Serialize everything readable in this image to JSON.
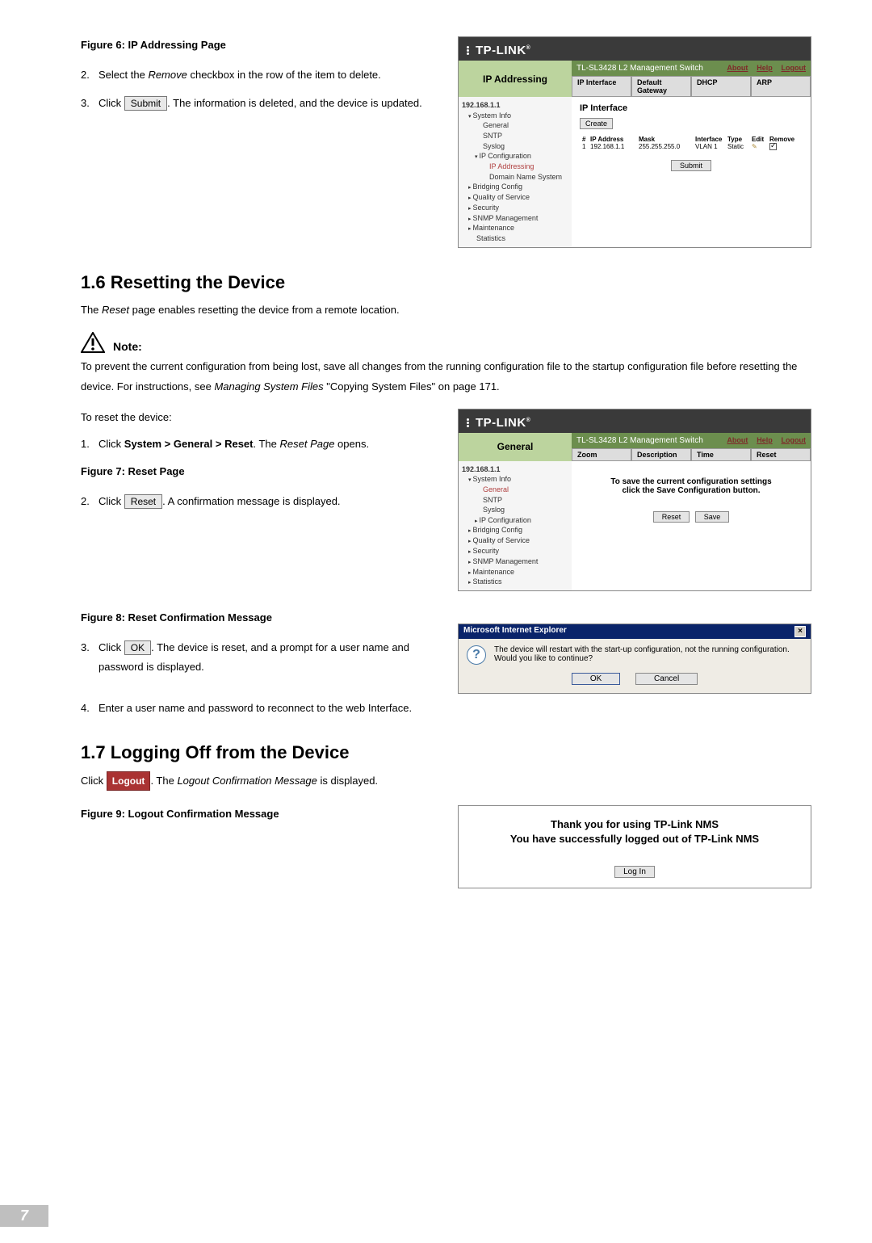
{
  "fig6": {
    "label": "Figure 6: IP Addressing Page"
  },
  "step2": {
    "num": "2.",
    "text_a": "Select the ",
    "rem": "Remove",
    "text_b": " checkbox in the row of the item to delete."
  },
  "step3": {
    "num": "3.",
    "text_a": "Click ",
    "btn": "Submit",
    "text_b": ". The information is deleted, and the device is updated."
  },
  "ss1": {
    "logo": "TP-LINK",
    "title_label": "IP Addressing",
    "product": "TL-SL3428 L2 Management Switch",
    "about": "About",
    "help": "Help",
    "logout": "Logout",
    "tabs": [
      "IP Interface",
      "Default Gateway",
      "DHCP",
      "ARP"
    ],
    "tree_root": "192.168.1.1",
    "tree": {
      "sys": "System Info",
      "gen": "General",
      "sntp": "SNTP",
      "syslog": "Syslog",
      "ipc": "IP Configuration",
      "ipaddr": "IP Addressing",
      "dns": "Domain Name System",
      "bridge": "Bridging Config",
      "qos": "Quality of Service",
      "sec": "Security",
      "snmp": "SNMP Management",
      "maint": "Maintenance",
      "stats": "Statistics"
    },
    "main": {
      "heading": "IP Interface",
      "create": "Create",
      "hdr": {
        "n": "#",
        "ip": "IP Address",
        "mask": "Mask",
        "if": "Interface",
        "type": "Type",
        "edit": "Edit",
        "rem": "Remove"
      },
      "row": {
        "n": "1",
        "ip": "192.168.1.1",
        "mask": "255.255.255.0",
        "if": "VLAN 1",
        "type": "Static"
      },
      "submit": "Submit"
    }
  },
  "h16": "1.6   Resetting the Device",
  "p161": {
    "a": "The ",
    "r": "Reset",
    "b": " page enables resetting the device from a remote location."
  },
  "note": {
    "label": "Note:"
  },
  "p162": {
    "a": "To prevent the current configuration from being lost, save all changes from the running configuration file to the startup configuration file before resetting the device. For instructions, see ",
    "i": "Managing System Files",
    "b": " \"Copying System Files\" on page 171."
  },
  "reset_intro": "To reset the device:",
  "r1": {
    "num": "1.",
    "a": "Click ",
    "path": "System > General > Reset",
    "b": ". The ",
    "i": "Reset Page",
    "c": " opens."
  },
  "fig7": {
    "label": "Figure 7: Reset Page"
  },
  "r2": {
    "num": "2.",
    "a": "Click ",
    "btn": "Reset",
    "b": ". A confirmation message is displayed."
  },
  "ss2": {
    "logo": "TP-LINK",
    "title_label": "General",
    "product": "TL-SL3428 L2 Management Switch",
    "about": "About",
    "help": "Help",
    "logout": "Logout",
    "tabs": [
      "Zoom",
      "Description",
      "Time",
      "Reset"
    ],
    "tree_root": "192.168.1.1",
    "msg1": "To save the current configuration settings",
    "msg2": "click the Save Configuration button.",
    "reset": "Reset",
    "save": "Save"
  },
  "fig8": {
    "label": "Figure 8: Reset Confirmation Message"
  },
  "ie": {
    "title": "Microsoft Internet Explorer",
    "x": "×",
    "msg": "The device will restart with the start-up configuration, not the running configuration. Would you like to continue?",
    "ok": "OK",
    "cancel": "Cancel"
  },
  "r3": {
    "num": "3.",
    "a": "Click ",
    "btn": "OK",
    "b": ". The device is reset, and a prompt for a user name and password is displayed."
  },
  "r4": {
    "num": "4.",
    "text": "Enter a user name and password to reconnect to the web Interface."
  },
  "h17": "1.7   Logging Off from the Device",
  "p171": {
    "a": "Click ",
    "btn": "Logout",
    "b": ". The ",
    "i": "Logout Confirmation Message",
    "c": " is displayed."
  },
  "fig9": {
    "label": "Figure 9: Logout Confirmation Message"
  },
  "logout_box": {
    "l1": "Thank you for using TP-Link NMS",
    "l2": "You have successfully logged out of TP-Link NMS",
    "login": "Log In"
  },
  "page_num": "7"
}
